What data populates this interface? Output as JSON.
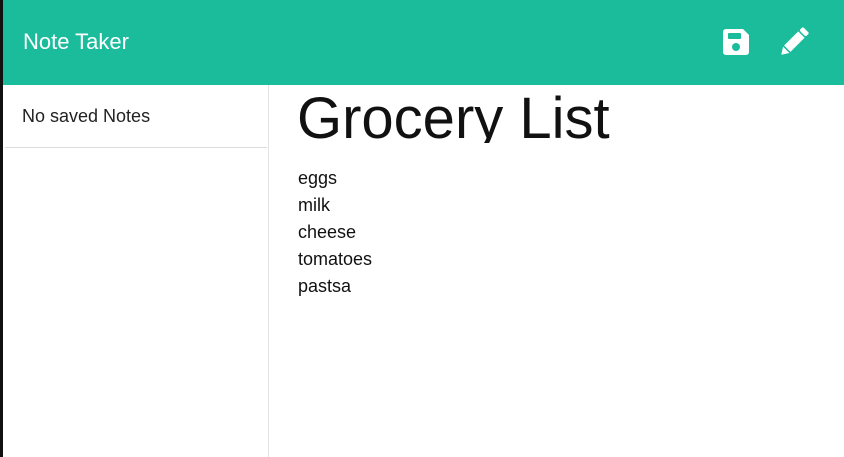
{
  "navbar": {
    "brand": "Note Taker",
    "background_color": "#1abc9c",
    "actions": [
      {
        "icon": "save-icon"
      },
      {
        "icon": "pencil-icon"
      }
    ]
  },
  "sidebar": {
    "items": [
      {
        "label": "No saved Notes"
      }
    ]
  },
  "note": {
    "title": "Grocery List",
    "lines": [
      "eggs",
      "milk",
      "cheese",
      "tomatoes",
      "pastsa"
    ]
  }
}
